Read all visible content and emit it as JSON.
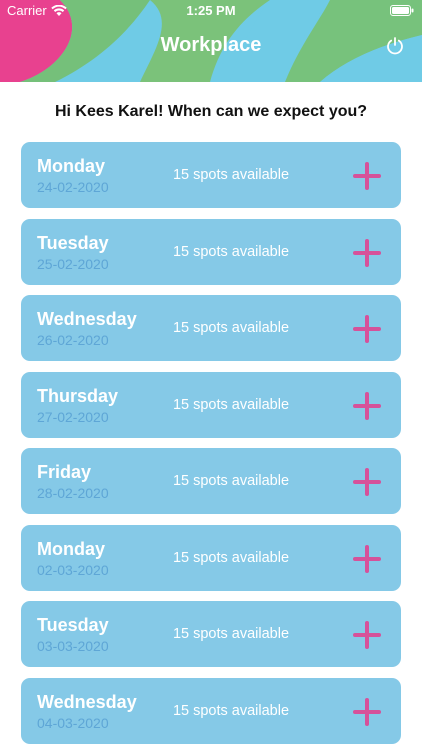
{
  "status_bar": {
    "carrier": "Carrier",
    "time": "1:25 PM"
  },
  "header": {
    "title": "Workplace",
    "power_icon": "power-icon"
  },
  "prompt": "Hi Kees Karel! When can we expect you?",
  "colors": {
    "card": "#85c9e7",
    "date": "#5ea6d6",
    "add": "#d6519a"
  },
  "days": [
    {
      "day": "Monday",
      "date": "24-02-2020",
      "spots": "15 spots available"
    },
    {
      "day": "Tuesday",
      "date": "25-02-2020",
      "spots": "15 spots available"
    },
    {
      "day": "Wednesday",
      "date": "26-02-2020",
      "spots": "15 spots available"
    },
    {
      "day": "Thursday",
      "date": "27-02-2020",
      "spots": "15 spots available"
    },
    {
      "day": "Friday",
      "date": "28-02-2020",
      "spots": "15 spots available"
    },
    {
      "day": "Monday",
      "date": "02-03-2020",
      "spots": "15 spots available"
    },
    {
      "day": "Tuesday",
      "date": "03-03-2020",
      "spots": "15 spots available"
    },
    {
      "day": "Wednesday",
      "date": "04-03-2020",
      "spots": "15 spots available"
    }
  ]
}
